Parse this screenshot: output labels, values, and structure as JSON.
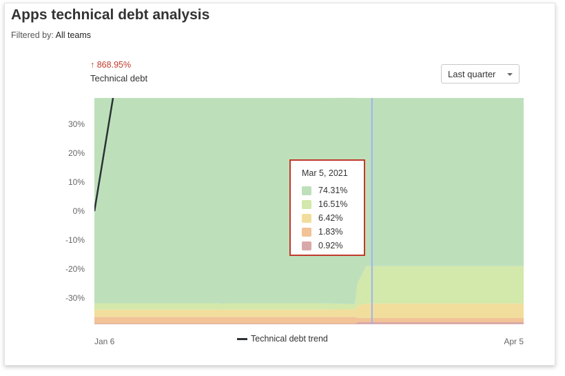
{
  "header": {
    "title": "Apps technical debt analysis",
    "filter_label": "Filtered by:",
    "filter_value": "All teams"
  },
  "metric": {
    "delta": "868.95%",
    "delta_icon": "up-arrow-icon",
    "label": "Technical debt"
  },
  "range_select": {
    "value": "Last quarter"
  },
  "legend": {
    "trend_label": "Technical debt trend"
  },
  "tooltip": {
    "date": "Mar 5, 2021",
    "rows": [
      {
        "value": "74.31%",
        "color": "#bde0bb"
      },
      {
        "value": "16.51%",
        "color": "#d3e8ab"
      },
      {
        "value": "6.42%",
        "color": "#f2de9c"
      },
      {
        "value": "1.83%",
        "color": "#f1c397"
      },
      {
        "value": "0.92%",
        "color": "#d9a9a9"
      }
    ]
  },
  "chart_data": {
    "type": "area",
    "x_ticks": [
      "Jan 6",
      "Apr 5"
    ],
    "y_ticks": [
      "30%",
      "20%",
      "10%",
      "0%",
      "-10%",
      "-20%",
      "-30%"
    ],
    "y_tick_values": [
      30,
      20,
      10,
      0,
      -10,
      -20,
      -30
    ],
    "ylim": [
      -39,
      39
    ],
    "x_days": [
      0,
      44,
      45,
      46,
      78,
      91,
      92,
      95,
      97,
      150
    ],
    "bands": [
      {
        "color": "#d9a9a9",
        "values": [
          0.3,
          0.3,
          0.3,
          0.3,
          0.3,
          0.3,
          0.9,
          0.92,
          0.92,
          0.92
        ]
      },
      {
        "color": "#f1c397",
        "values": [
          3.0,
          3.0,
          3.0,
          3.0,
          3.0,
          3.0,
          1.9,
          1.83,
          1.83,
          1.83
        ]
      },
      {
        "color": "#f2de9c",
        "values": [
          3.2,
          3.2,
          3.2,
          3.2,
          3.2,
          3.3,
          5.5,
          6.42,
          6.42,
          6.42
        ]
      },
      {
        "color": "#d3e8ab",
        "values": [
          2.8,
          2.8,
          2.3,
          2.8,
          2.8,
          2.3,
          10.0,
          16.51,
          16.51,
          16.51
        ]
      },
      {
        "color": "#bde0bb",
        "values": [
          90.7,
          90.7,
          91.2,
          90.7,
          90.7,
          91.2,
          81.7,
          74.31,
          74.31,
          74.31
        ]
      }
    ],
    "trend": {
      "name": "Technical debt trend",
      "color": "#2b3135",
      "x_days": [
        0,
        6.5
      ],
      "values": [
        0,
        39
      ]
    },
    "cursor_x_day": 97,
    "cursor_color": "#9db2f0"
  }
}
